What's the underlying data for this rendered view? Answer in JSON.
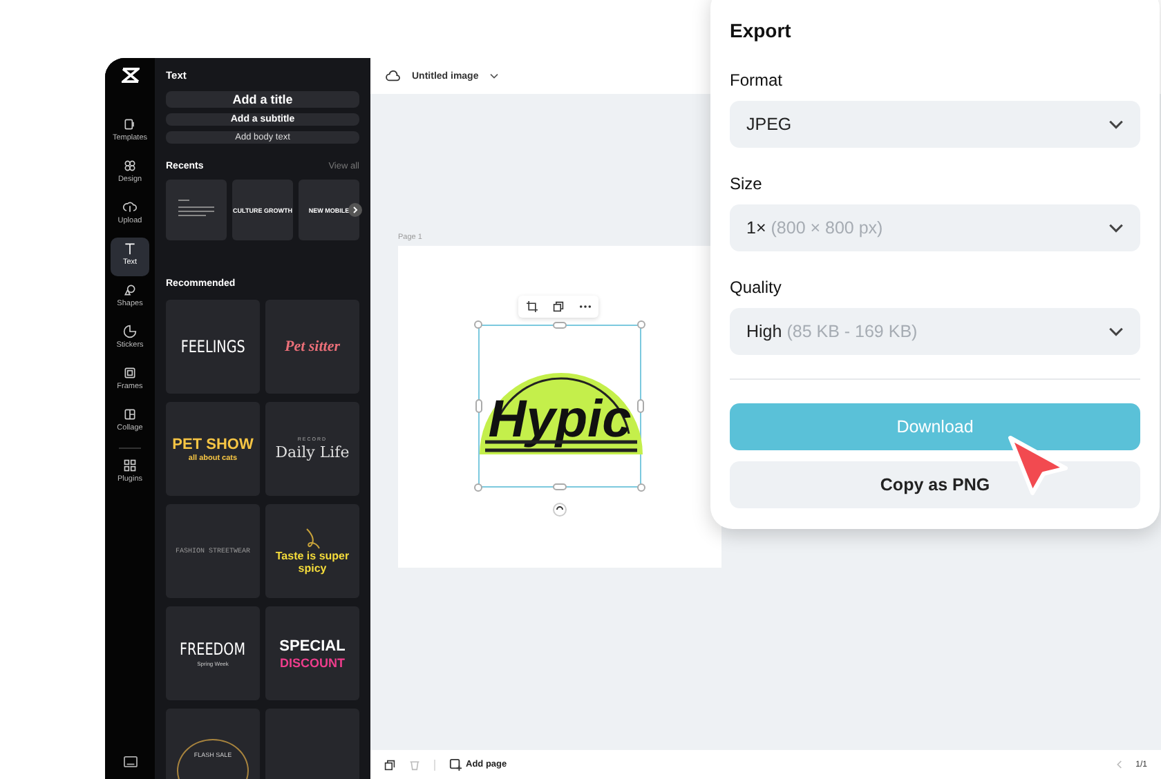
{
  "rail": {
    "items": [
      {
        "label": "Templates",
        "selected": false
      },
      {
        "label": "Design",
        "selected": false
      },
      {
        "label": "Upload",
        "selected": false
      },
      {
        "label": "Text",
        "selected": true
      },
      {
        "label": "Shapes",
        "selected": false
      },
      {
        "label": "Stickers",
        "selected": false
      },
      {
        "label": "Frames",
        "selected": false
      },
      {
        "label": "Collage",
        "selected": false
      },
      {
        "label": "Plugins",
        "selected": false
      }
    ]
  },
  "text_panel": {
    "title": "Text",
    "add_buttons": [
      "Add a title",
      "Add a subtitle",
      "Add body text"
    ],
    "recents": {
      "title": "Recents",
      "view_all": "View all",
      "items": [
        {
          "kind": "doc"
        },
        {
          "kind": "caption",
          "text": "CULTURE GROWTH"
        },
        {
          "kind": "caption",
          "text": "NEW MOBILE"
        }
      ]
    },
    "recommended": {
      "title": "Recommended",
      "cards": [
        {
          "kind": "thin",
          "text": "FEELINGS"
        },
        {
          "kind": "script",
          "text": "Pet sitter"
        },
        {
          "kind": "pet",
          "text": "PET SHOW",
          "sub": "all about cats"
        },
        {
          "kind": "serif",
          "text": "Daily Life",
          "sup": "RECORD"
        },
        {
          "kind": "fashion",
          "text": "FASHION STREETWEAR"
        },
        {
          "kind": "spicy",
          "text": "Taste is super spicy"
        },
        {
          "kind": "thin",
          "text": "FREEDOM",
          "sub": "Spring Week"
        },
        {
          "kind": "special",
          "text": "SPECIAL",
          "sub": "DISCOUNT"
        },
        {
          "kind": "sale",
          "text": "FLASH SALE"
        },
        {
          "kind": "blank"
        }
      ]
    }
  },
  "canvas": {
    "file_name": "Untitled image",
    "page_label": "Page 1",
    "logo_text": "Hypic",
    "add_page": "Add page",
    "page_count": "1/1"
  },
  "export": {
    "title": "Export",
    "fields": [
      {
        "label": "Format",
        "value": "JPEG"
      },
      {
        "label": "Size",
        "value": "1×",
        "detail": "(800 × 800 px)"
      },
      {
        "label": "Quality",
        "value": "High",
        "detail": "(85 KB - 169 KB)"
      }
    ],
    "primary": "Download",
    "secondary": "Copy as PNG"
  }
}
